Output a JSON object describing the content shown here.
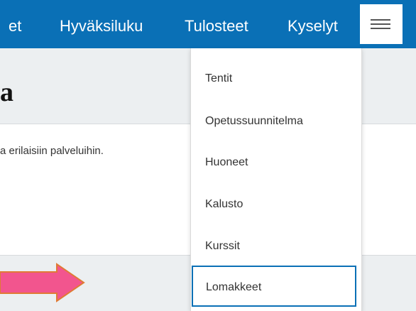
{
  "nav": {
    "items": [
      {
        "label": "et"
      },
      {
        "label": "Hyväksiluku"
      },
      {
        "label": "Tulosteet"
      },
      {
        "label": "Kyselyt"
      }
    ],
    "menu_icon": "hamburger-menu-icon"
  },
  "page": {
    "heading_fragment": "a",
    "intro_text": "a erilaisiin palveluihin."
  },
  "dropdown": {
    "items": [
      {
        "label": "Tentit"
      },
      {
        "label": "Opetussuunnitelma"
      },
      {
        "label": "Huoneet"
      },
      {
        "label": "Kalusto"
      },
      {
        "label": "Kurssit"
      },
      {
        "label": "Lomakkeet",
        "selected": true
      }
    ]
  },
  "annotation": {
    "icon": "right-arrow-icon",
    "fill_color": "#f2558e",
    "stroke_color": "#e07a35"
  },
  "colors": {
    "nav_bg": "#0a70b6",
    "nav_text": "#ffffff",
    "selected_border": "#0a70b6"
  }
}
